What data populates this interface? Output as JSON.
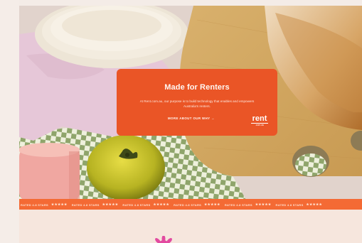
{
  "card": {
    "title": "Made for Renters",
    "body": "At Rent.com.au, our purpose is to build technology that enables and empowers Australia's renters.",
    "cta": "MORE ABOUT OUR WHY →",
    "logo_word": "rent",
    "logo_sub": ".com.au"
  },
  "ribbon": {
    "items": [
      {
        "label": "RATED 4.8 STARS",
        "stars": "★★★★★"
      },
      {
        "label": "RATED 4.8 STARS",
        "stars": "★★★★★"
      },
      {
        "label": "RATED 4.8 STARS",
        "stars": "★★★★★"
      },
      {
        "label": "RATED 4.8 STARS",
        "stars": "★★★★★"
      },
      {
        "label": "RATED 4.8 STARS",
        "stars": "★★★★★"
      },
      {
        "label": "RATED 4.8 STARS",
        "stars": "★★★★★"
      }
    ]
  },
  "colors": {
    "card": "#ea5526",
    "ribbon": "#f46a34",
    "background": "#f3e9e2"
  }
}
